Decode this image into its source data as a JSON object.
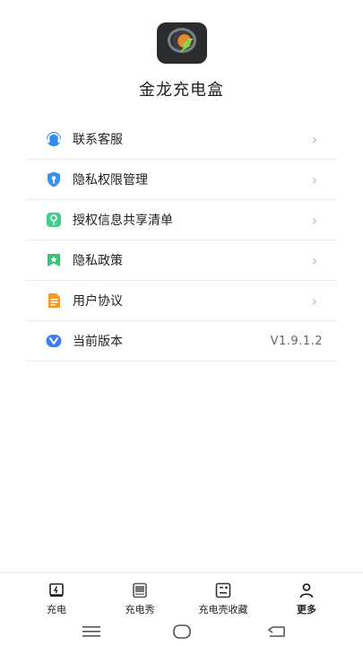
{
  "app": {
    "name": "金龙充电盒"
  },
  "menu": [
    {
      "label": "联系客服",
      "icon": "headset-icon",
      "color": "#2f8ef0"
    },
    {
      "label": "隐私权限管理",
      "icon": "shield-key-icon",
      "color": "#3d8ff2"
    },
    {
      "label": "授权信息共享清单",
      "icon": "key-card-icon",
      "color": "#3ecf8e"
    },
    {
      "label": "隐私政策",
      "icon": "bookmark-star-icon",
      "color": "#3fc17c"
    },
    {
      "label": "用户协议",
      "icon": "document-icon",
      "color": "#f59a2c"
    },
    {
      "label": "当前版本",
      "icon": "version-v-icon",
      "color": "#3d7ff2",
      "value": "V1.9.1.2"
    }
  ],
  "tabs": [
    {
      "label": "充电",
      "icon": "charge-icon"
    },
    {
      "label": "充电秀",
      "icon": "phone-icon"
    },
    {
      "label": "充电壳收藏",
      "icon": "gallery-icon"
    },
    {
      "label": "更多",
      "icon": "user-icon",
      "active": true
    }
  ],
  "system_nav": [
    "menu-icon",
    "home-icon",
    "back-icon"
  ]
}
